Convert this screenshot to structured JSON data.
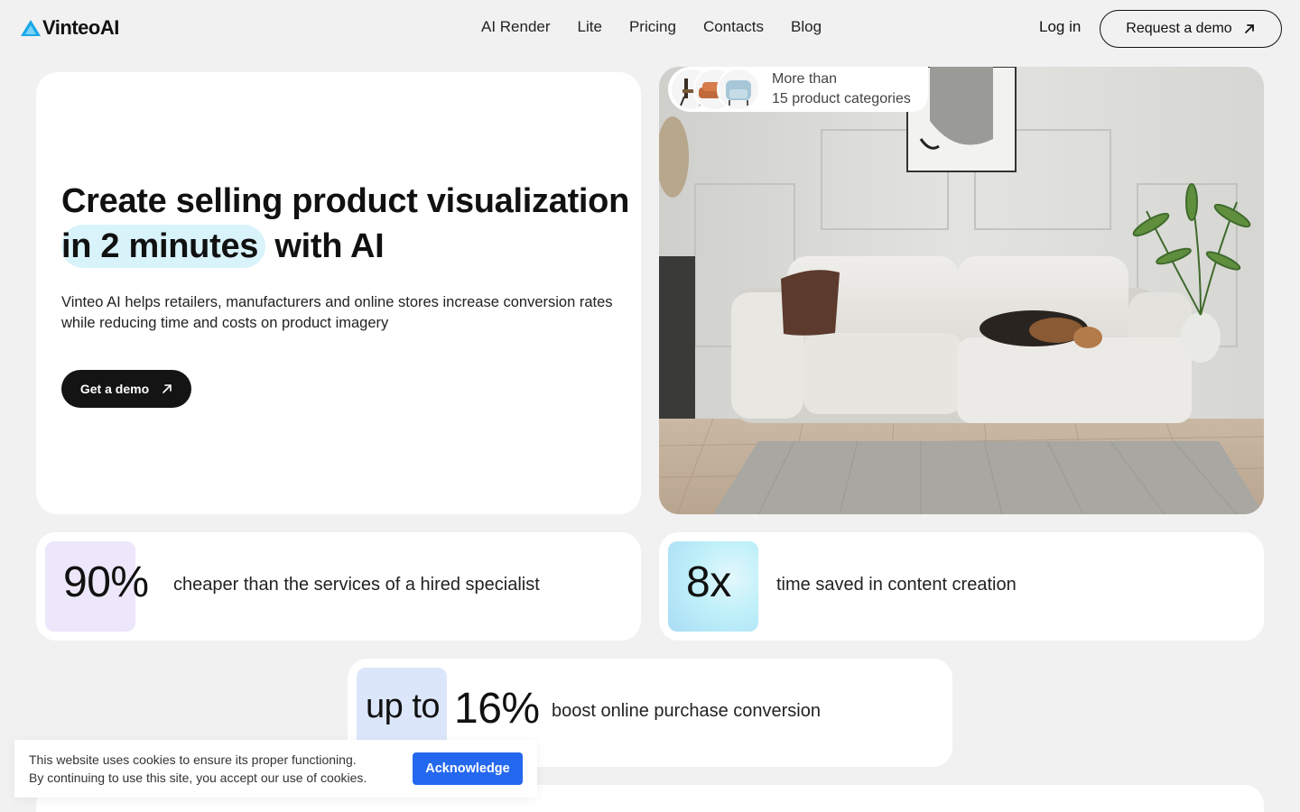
{
  "header": {
    "logo": "VinteoAI",
    "nav": [
      "AI Render",
      "Lite",
      "Pricing",
      "Contacts",
      "Blog"
    ],
    "login": "Log in",
    "request_demo": "Request a demo"
  },
  "hero": {
    "title_line1": "Create selling product visualization",
    "title_highlight": "in 2 minutes",
    "title_rest": "with AI",
    "subtitle": "Vinteo AI helps retailers, manufacturers and online stores increase conversion rates while reducing time and costs on product imagery",
    "cta": "Get a demo"
  },
  "categories": {
    "line1": "More than",
    "line2": "15 product categories"
  },
  "stats": [
    {
      "value": "90%",
      "text": "cheaper than the services of a hired specialist",
      "badge_color": "#ece7fb"
    },
    {
      "value": "8x",
      "text": "time saved in content creation",
      "badge_color": "#bff0f9"
    },
    {
      "value_prefix": "up to",
      "value": "16%",
      "text": "boost online purchase conversion",
      "badge_color": "#dce6fb"
    }
  ],
  "cookie": {
    "line1": "This website uses cookies to ensure its proper functioning.",
    "line2": "By continuing to use this site, you accept our use of cookies.",
    "button": "Acknowledge"
  },
  "colors": {
    "page_bg": "#f1f1f1",
    "accent_blue": "#2468ef",
    "highlight": "#d9f3fb",
    "dark_button": "#141414"
  }
}
